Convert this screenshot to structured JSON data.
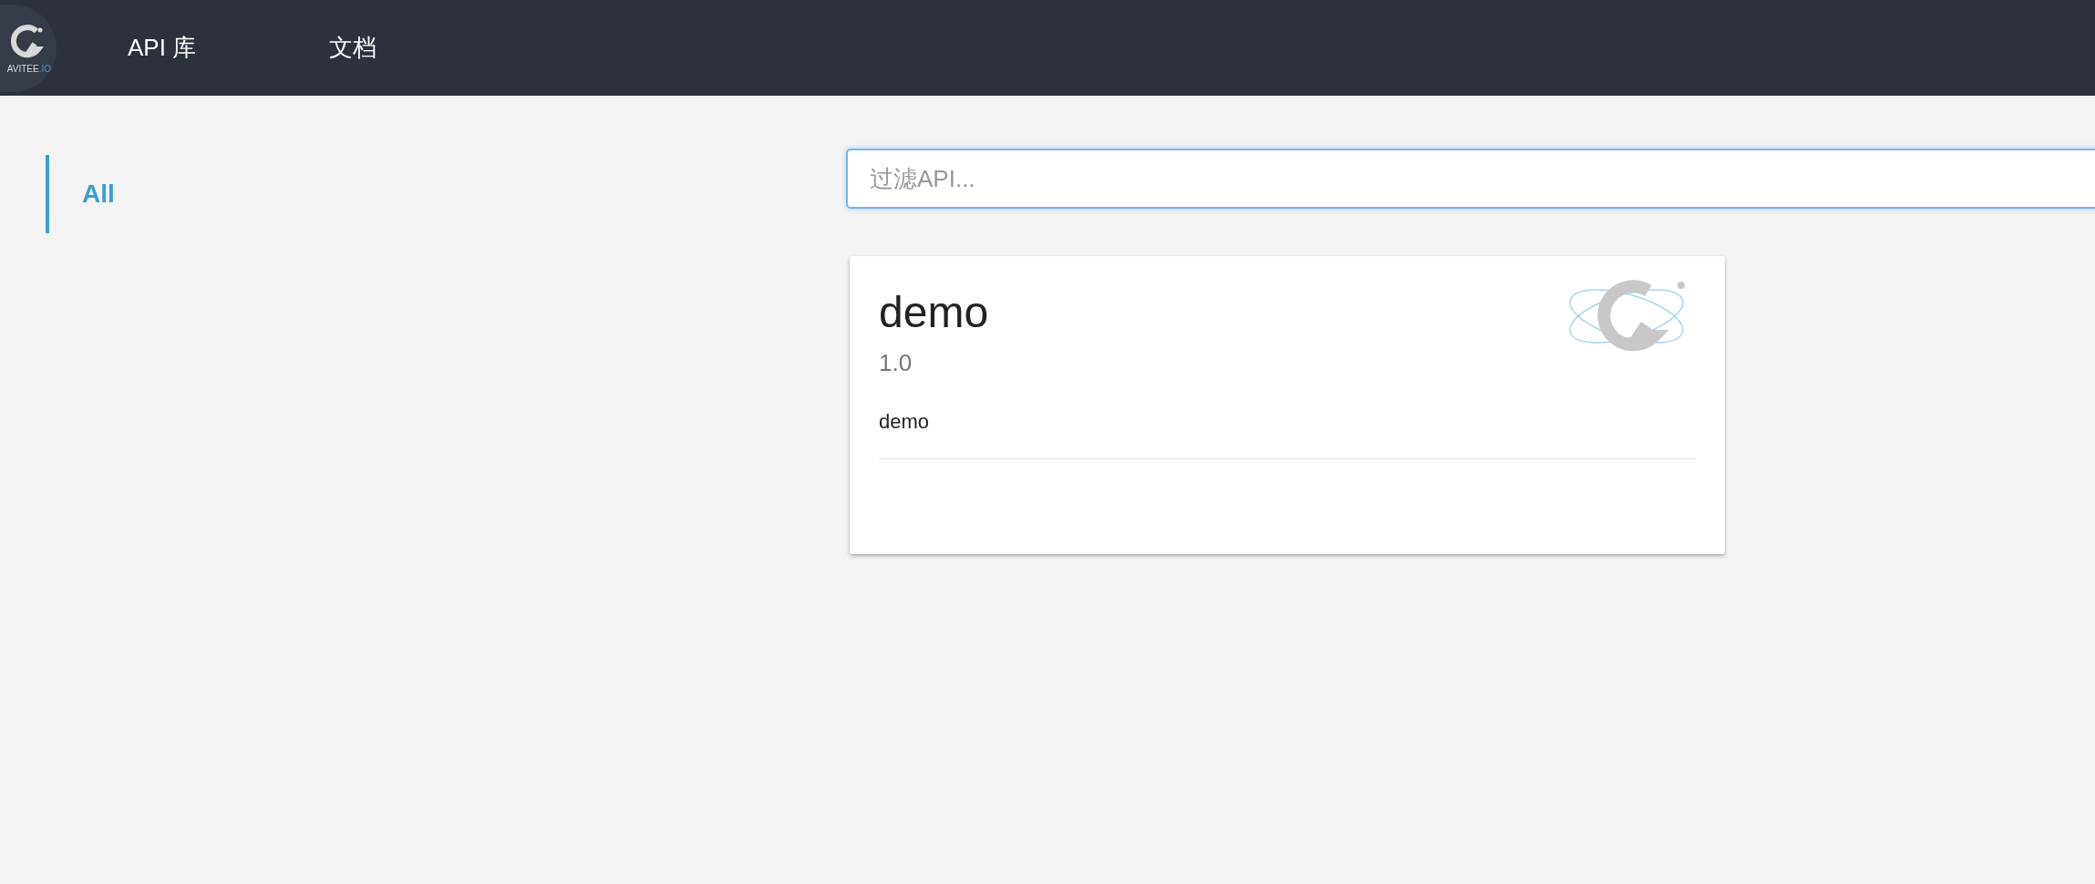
{
  "header": {
    "logo": {
      "text": "AVITEE",
      "suffix": ".IO"
    },
    "nav": [
      {
        "label": "API 库"
      },
      {
        "label": "文档"
      }
    ]
  },
  "sidebar": {
    "items": [
      {
        "label": "All",
        "selected": true
      }
    ]
  },
  "search": {
    "placeholder": "过滤API..."
  },
  "apis": [
    {
      "name": "demo",
      "version": "1.0",
      "description": "demo"
    }
  ]
}
